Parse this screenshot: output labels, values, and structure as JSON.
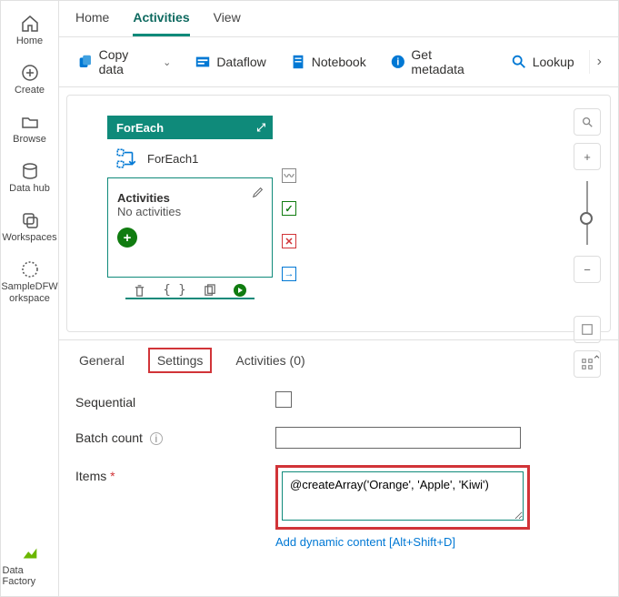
{
  "rail": {
    "home": "Home",
    "create": "Create",
    "browse": "Browse",
    "datahub": "Data hub",
    "workspaces": "Workspaces",
    "sample": "SampleDFW orkspace",
    "factory": "Data Factory"
  },
  "tabs": {
    "home": "Home",
    "activities": "Activities",
    "view": "View"
  },
  "toolbar": {
    "copydata": "Copy data",
    "dataflow": "Dataflow",
    "notebook": "Notebook",
    "getmetadata": "Get metadata",
    "lookup": "Lookup"
  },
  "foreach": {
    "header": "ForEach",
    "name": "ForEach1",
    "activities_title": "Activities",
    "activities_sub": "No activities"
  },
  "bottom": {
    "general": "General",
    "settings": "Settings",
    "activities": "Activities (0)",
    "sequential": "Sequential",
    "batchcount": "Batch count",
    "items": "Items",
    "items_value": "@createArray('Orange', 'Apple', 'Kiwi')",
    "dynamic": "Add dynamic content [Alt+Shift+D]"
  }
}
